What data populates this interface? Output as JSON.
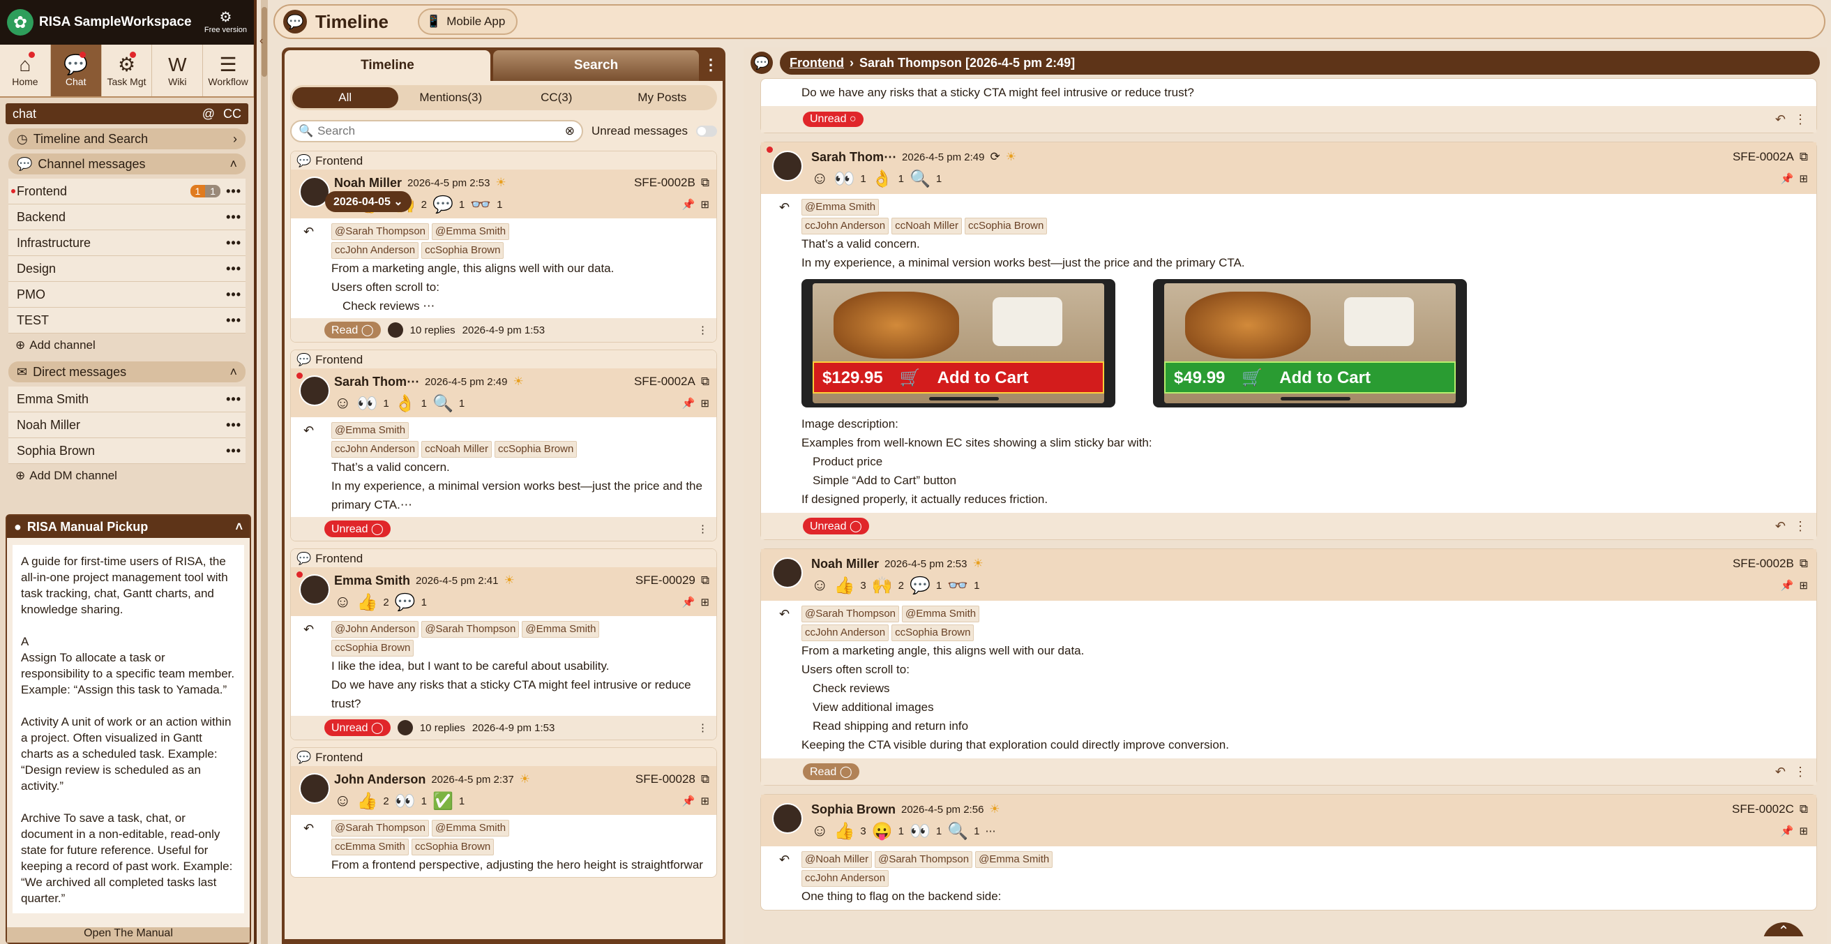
{
  "brand": {
    "title": "RISA SampleWorkspace",
    "free_version": "Free version"
  },
  "apps": [
    {
      "label": "Home",
      "icon": "⌂"
    },
    {
      "label": "Chat",
      "icon": "💬"
    },
    {
      "label": "Task Mgt",
      "icon": "⚙"
    },
    {
      "label": "Wiki",
      "icon": "W"
    },
    {
      "label": "Workflow",
      "icon": "☰"
    }
  ],
  "sidebar": {
    "search_title": "chat",
    "at": "@",
    "cc": "CC",
    "timeline_search": "Timeline and Search",
    "channel_messages": "Channel messages",
    "channels": [
      "Frontend",
      "Backend",
      "Infrastructure",
      "Design",
      "PMO",
      "TEST"
    ],
    "frontend_badge1": "1",
    "frontend_badge2": "1",
    "add_channel": "Add channel",
    "direct_messages": "Direct messages",
    "dms": [
      "Emma Smith",
      "Noah Miller",
      "Sophia Brown"
    ],
    "add_dm": "Add DM channel"
  },
  "pickup": {
    "title": "RISA Manual Pickup",
    "body": "A guide for first-time users of RISA, the all-in-one project management tool with task tracking, chat, Gantt charts, and knowledge sharing.\n\nA\nAssign  To allocate a task or responsibility to a specific team member. Example: “Assign this task to Yamada.”\n\nActivity  A unit of work or an action within a project. Often visualized in Gantt charts as a scheduled task. Example: “Design review is scheduled as an activity.”\n\nArchive  To save a task, chat, or document in a non-editable, read-only state for future reference. Useful for keeping a record of past work. Example: “We archived all completed tasks last quarter.”\n\nB\nBacklog  A list of tasks that are planned",
    "open_manual": "Open The Manual"
  },
  "topbar": {
    "title": "Timeline",
    "mobile_app": "Mobile App"
  },
  "mid": {
    "tab_timeline": "Timeline",
    "tab_search": "Search",
    "filters": [
      "All",
      "Mentions(3)",
      "CC(3)",
      "My Posts"
    ],
    "search_placeholder": "Search",
    "unread_messages": "Unread messages",
    "date_pill": "2026-04-05",
    "cards": [
      {
        "channel": "Frontend",
        "name": "Noah Miller",
        "time": "2026-4-5 pm 2:53",
        "id": "SFE-0002B",
        "reactions": [
          {
            "e": "👍",
            "n": "3"
          },
          {
            "e": "🙌",
            "n": "2"
          },
          {
            "e": "💬",
            "n": "1"
          },
          {
            "e": "👓",
            "n": "1"
          }
        ],
        "to": [
          "@Sarah Thompson",
          "@Emma Smith"
        ],
        "cc": [
          "ccJohn Anderson",
          "ccSophia Brown"
        ],
        "lines": [
          "From a marketing angle, this aligns well with our data.",
          "Users often scroll to:"
        ],
        "indent": [
          "Check reviews ⋯"
        ],
        "status": "Read",
        "replies": "10 replies",
        "reply_time": "2026-4-9 pm 1:53"
      },
      {
        "channel": "Frontend",
        "name": "Sarah Thom⋯",
        "time": "2026-4-5 pm 2:49",
        "id": "SFE-0002A",
        "reactions": [
          {
            "e": "👀",
            "n": "1"
          },
          {
            "e": "👌",
            "n": "1"
          },
          {
            "e": "🔍",
            "n": "1"
          }
        ],
        "to": [
          "@Emma Smith"
        ],
        "cc": [
          "ccJohn Anderson",
          "ccNoah Miller",
          "ccSophia Brown"
        ],
        "lines": [
          "That’s a valid concern.",
          "In my experience, a minimal version works best—just the price and the primary CTA.⋯"
        ],
        "indent": [],
        "status": "Unread",
        "replies": "",
        "reply_time": ""
      },
      {
        "channel": "Frontend",
        "name": "Emma Smith",
        "time": "2026-4-5 pm 2:41",
        "id": "SFE-00029",
        "reactions": [
          {
            "e": "👍",
            "n": "2"
          },
          {
            "e": "💬",
            "n": "1"
          }
        ],
        "to": [
          "@John Anderson",
          "@Sarah Thompson",
          "@Emma Smith"
        ],
        "cc": [
          "ccSophia Brown"
        ],
        "lines": [
          "I like the idea, but I want to be careful about usability.",
          "Do we have any risks that a sticky CTA might feel intrusive or reduce trust?"
        ],
        "indent": [],
        "status": "Unread",
        "replies": "10 replies",
        "reply_time": "2026-4-9 pm 1:53"
      },
      {
        "channel": "Frontend",
        "name": "John Anderson",
        "time": "2026-4-5 pm 2:37",
        "id": "SFE-00028",
        "reactions": [
          {
            "e": "👍",
            "n": "2"
          },
          {
            "e": "👀",
            "n": "1"
          },
          {
            "e": "✅",
            "n": "1"
          }
        ],
        "to": [
          "@Sarah Thompson",
          "@Emma Smith"
        ],
        "cc": [
          "ccEmma Smith",
          "ccSophia Brown"
        ],
        "lines": [
          "From a frontend perspective, adjusting the hero height is straightforwar"
        ],
        "indent": [],
        "status": "",
        "replies": "",
        "reply_time": ""
      }
    ]
  },
  "right": {
    "crumb_channel": "Frontend",
    "crumb_title": "Sarah Thompson [2026-4-5 pm 2:49]",
    "top_line": "Do we have any risks that a sticky CTA might feel intrusive or reduce trust?",
    "top_status": "Unread",
    "messages": [
      {
        "name": "Sarah Thom⋯",
        "time": "2026-4-5 pm 2:49",
        "id": "SFE-0002A",
        "reactions": [
          {
            "e": "👀",
            "n": "1"
          },
          {
            "e": "👌",
            "n": "1"
          },
          {
            "e": "🔍",
            "n": "1"
          }
        ],
        "to": [
          "@Emma Smith"
        ],
        "cc": [
          "ccJohn Anderson",
          "ccNoah Miller",
          "ccSophia Brown"
        ],
        "lines": [
          "That’s a valid concern.",
          "In my experience, a minimal version works best—just the price and the primary CTA."
        ],
        "images": [
          {
            "price": "$129.95",
            "cta": "Add to Cart"
          },
          {
            "price": "$49.99",
            "cta": "Add to Cart"
          }
        ],
        "after": [
          "Image description:",
          "Examples from well-known EC sites showing a slim sticky bar with:"
        ],
        "indent": [
          "Product price",
          "Simple “Add to Cart” button"
        ],
        "after2": [
          "If designed properly, it actually reduces friction."
        ],
        "status": "Unread"
      },
      {
        "name": "Noah Miller",
        "time": "2026-4-5 pm 2:53",
        "id": "SFE-0002B",
        "reactions": [
          {
            "e": "👍",
            "n": "3"
          },
          {
            "e": "🙌",
            "n": "2"
          },
          {
            "e": "💬",
            "n": "1"
          },
          {
            "e": "👓",
            "n": "1"
          }
        ],
        "to": [
          "@Sarah Thompson",
          "@Emma Smith"
        ],
        "cc": [
          "ccJohn Anderson",
          "ccSophia Brown"
        ],
        "lines": [
          "From a marketing angle, this aligns well with our data.",
          "Users often scroll to:"
        ],
        "indent": [
          "Check reviews",
          "View additional images",
          "Read shipping and return info"
        ],
        "after2": [
          "Keeping the CTA visible during that exploration could directly improve conversion."
        ],
        "status": "Read"
      },
      {
        "name": "Sophia Brown",
        "time": "2026-4-5 pm 2:56",
        "id": "SFE-0002C",
        "reactions": [
          {
            "e": "👍",
            "n": "3"
          },
          {
            "e": "😛",
            "n": "1"
          },
          {
            "e": "👀",
            "n": "1"
          },
          {
            "e": "🔍",
            "n": "1"
          }
        ],
        "more": "⋯",
        "to": [
          "@Noah Miller",
          "@Sarah Thompson",
          "@Emma Smith"
        ],
        "cc": [
          "ccJohn Anderson"
        ],
        "lines": [
          "One thing to flag on the backend side:"
        ]
      }
    ]
  }
}
